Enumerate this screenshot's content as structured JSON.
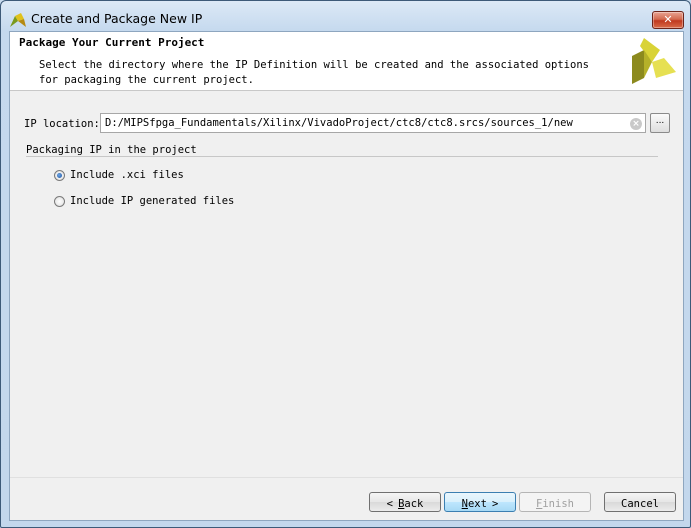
{
  "window": {
    "title": "Create and Package New IP",
    "close_label": "✕"
  },
  "header": {
    "title": "Package Your Current Project",
    "description": "Select the directory where the IP Definition will be created and the associated options for packaging the current project."
  },
  "ip_location": {
    "label": "IP location:",
    "value": "D:/MIPSfpga_Fundamentals/Xilinx/VivadoProject/ctc8/ctc8.srcs/sources_1/new",
    "browse_label": "..."
  },
  "packaging": {
    "group_label": "Packaging IP in the project",
    "options": [
      {
        "label": "Include .xci files",
        "selected": true
      },
      {
        "label": "Include IP generated files",
        "selected": false
      }
    ]
  },
  "buttons": {
    "back": {
      "mnemonic": "B",
      "rest": "ack",
      "arrow": "<"
    },
    "next": {
      "mnemonic": "N",
      "rest": "ext",
      "arrow": ">"
    },
    "finish": {
      "mnemonic": "F",
      "rest": "inish"
    },
    "cancel": "Cancel"
  },
  "colors": {
    "logo_yellow": "#d9d336",
    "logo_olive": "#8c8a1e",
    "primary_border": "#3c7fb1"
  }
}
